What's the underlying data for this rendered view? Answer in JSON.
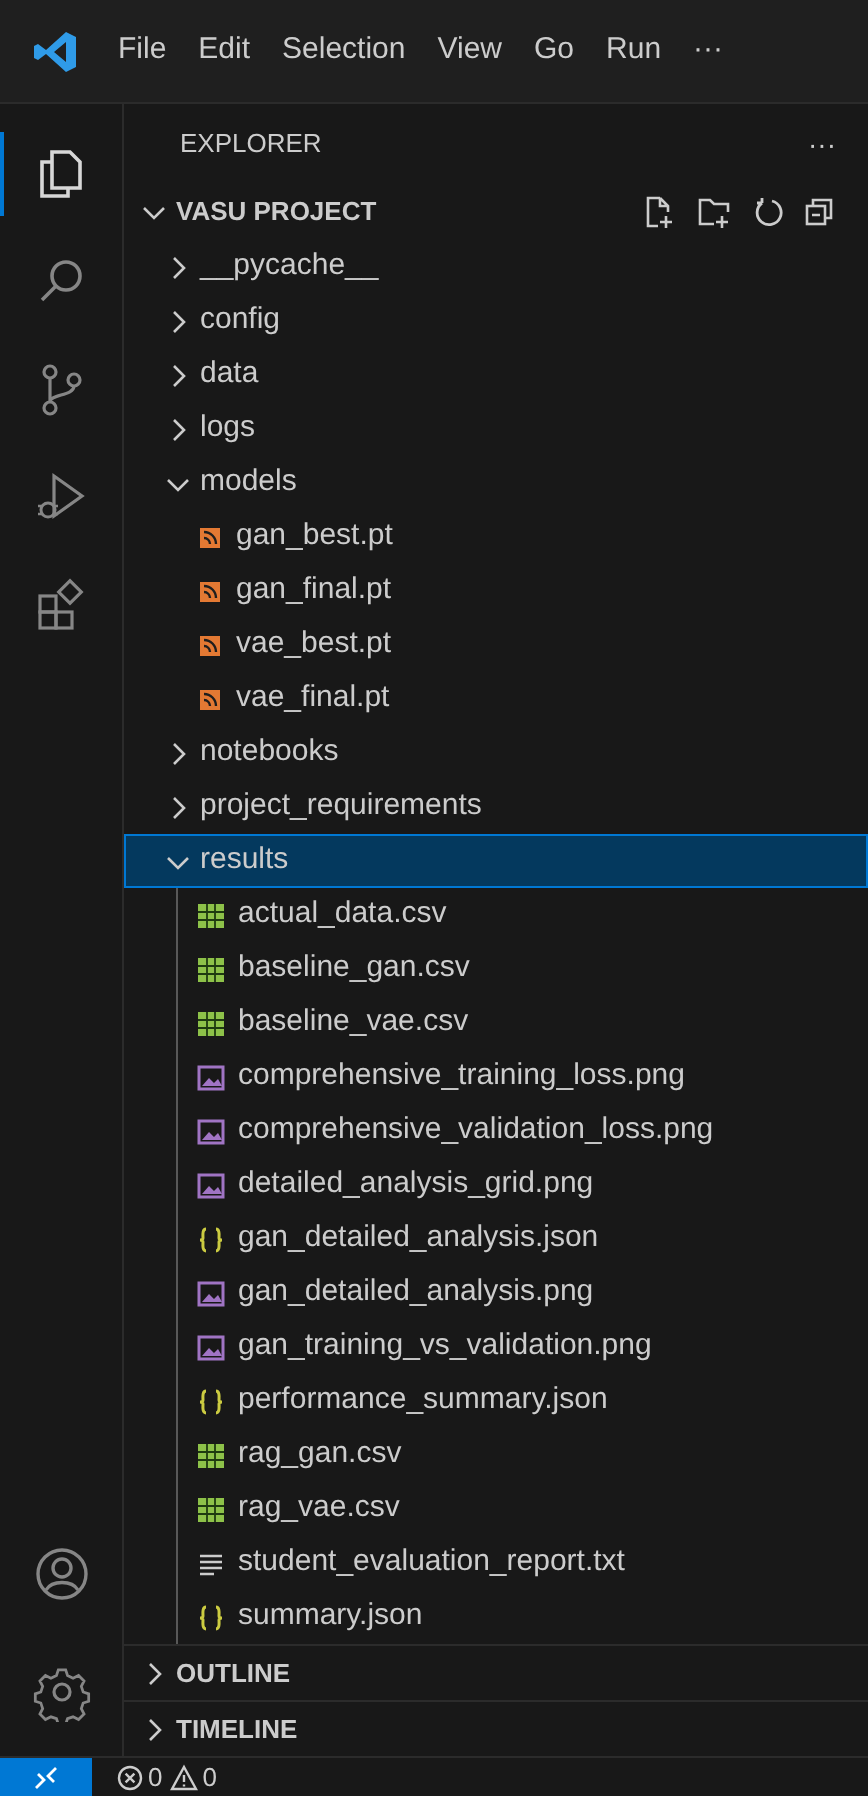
{
  "menu": [
    "File",
    "Edit",
    "Selection",
    "View",
    "Go",
    "Run",
    "···"
  ],
  "activity_bar": [
    {
      "kind": "explorer",
      "selected": true
    },
    {
      "kind": "search",
      "selected": false
    },
    {
      "kind": "source-control",
      "selected": false
    },
    {
      "kind": "run-debug",
      "selected": false
    },
    {
      "kind": "extensions",
      "selected": false
    }
  ],
  "explorer": {
    "title": "EXPLORER",
    "more": "···",
    "project": {
      "name": "VASU PROJECT",
      "expanded": true
    },
    "tree": [
      {
        "kind": "folder",
        "name": "__pycache__",
        "expanded": false,
        "selected": false
      },
      {
        "kind": "folder",
        "name": "config",
        "expanded": false,
        "selected": false
      },
      {
        "kind": "folder",
        "name": "data",
        "expanded": false,
        "selected": false
      },
      {
        "kind": "folder",
        "name": "logs",
        "expanded": false,
        "selected": false
      },
      {
        "kind": "folder",
        "name": "models",
        "expanded": true,
        "selected": false,
        "children": [
          {
            "kind": "pt",
            "name": "gan_best.pt"
          },
          {
            "kind": "pt",
            "name": "gan_final.pt"
          },
          {
            "kind": "pt",
            "name": "vae_best.pt"
          },
          {
            "kind": "pt",
            "name": "vae_final.pt"
          }
        ]
      },
      {
        "kind": "folder",
        "name": "notebooks",
        "expanded": false,
        "selected": false
      },
      {
        "kind": "folder",
        "name": "project_requirements",
        "expanded": false,
        "selected": false
      },
      {
        "kind": "folder",
        "name": "results",
        "expanded": true,
        "selected": true,
        "children": [
          {
            "kind": "csv",
            "name": "actual_data.csv"
          },
          {
            "kind": "csv",
            "name": "baseline_gan.csv"
          },
          {
            "kind": "csv",
            "name": "baseline_vae.csv"
          },
          {
            "kind": "png",
            "name": "comprehensive_training_loss.png"
          },
          {
            "kind": "png",
            "name": "comprehensive_validation_loss.png"
          },
          {
            "kind": "png",
            "name": "detailed_analysis_grid.png"
          },
          {
            "kind": "json",
            "name": "gan_detailed_analysis.json"
          },
          {
            "kind": "png",
            "name": "gan_detailed_analysis.png"
          },
          {
            "kind": "png",
            "name": "gan_training_vs_validation.png"
          },
          {
            "kind": "json",
            "name": "performance_summary.json"
          },
          {
            "kind": "csv",
            "name": "rag_gan.csv"
          },
          {
            "kind": "csv",
            "name": "rag_vae.csv"
          },
          {
            "kind": "txt",
            "name": "student_evaluation_report.txt"
          },
          {
            "kind": "json",
            "name": "summary.json"
          }
        ]
      }
    ]
  },
  "panels": [
    {
      "title": "OUTLINE",
      "expanded": false
    },
    {
      "title": "TIMELINE",
      "expanded": false
    }
  ],
  "status_bar": {
    "errors": "0",
    "warnings": "0"
  }
}
